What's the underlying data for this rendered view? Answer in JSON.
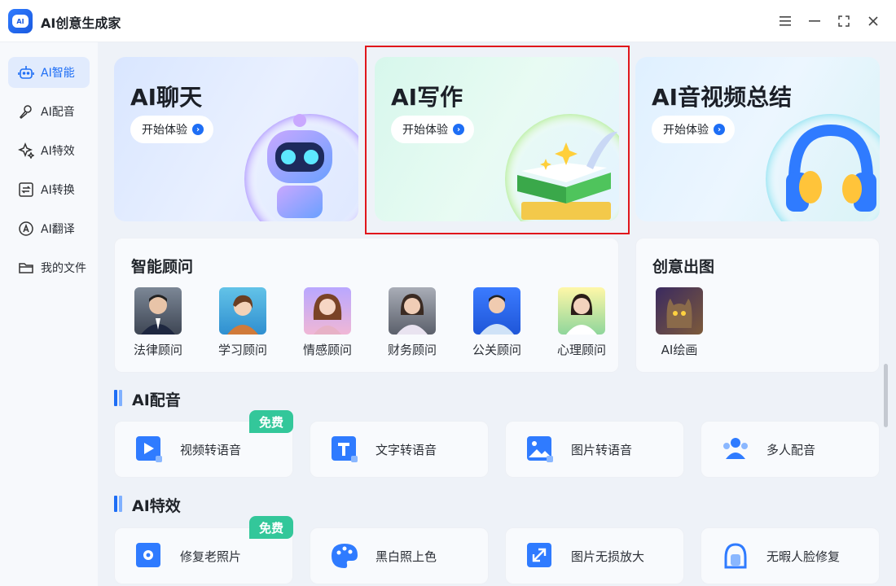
{
  "app": {
    "title": "AI创意生成家",
    "logo_text": "AI"
  },
  "window_controls": [
    "menu-icon",
    "minimize-icon",
    "maximize-icon",
    "close-icon"
  ],
  "sidebar": {
    "items": [
      {
        "label": "AI智能",
        "icon": "robot-icon",
        "active": true
      },
      {
        "label": "AI配音",
        "icon": "microphone-icon",
        "active": false
      },
      {
        "label": "AI特效",
        "icon": "sparkle-icon",
        "active": false
      },
      {
        "label": "AI转换",
        "icon": "convert-icon",
        "active": false
      },
      {
        "label": "AI翻译",
        "icon": "translate-icon",
        "active": false
      },
      {
        "label": "我的文件",
        "icon": "folder-icon",
        "active": false
      }
    ]
  },
  "hero": [
    {
      "title": "AI聊天",
      "button": "开始体验"
    },
    {
      "title": "AI写作",
      "button": "开始体验"
    },
    {
      "title": "AI音视频总结",
      "button": "开始体验"
    }
  ],
  "advisors": {
    "title": "智能顾问",
    "items": [
      {
        "name": "法律顾问"
      },
      {
        "name": "学习顾问"
      },
      {
        "name": "情感顾问"
      },
      {
        "name": "财务顾问"
      },
      {
        "name": "公关顾问"
      },
      {
        "name": "心理顾问"
      }
    ]
  },
  "creative": {
    "title": "创意出图",
    "items": [
      {
        "name": "AI绘画"
      }
    ]
  },
  "dubbing": {
    "title": "AI配音",
    "badge": "免费",
    "items": [
      {
        "label": "视频转语音",
        "icon": "video-to-voice-icon"
      },
      {
        "label": "文字转语音",
        "icon": "text-to-voice-icon"
      },
      {
        "label": "图片转语音",
        "icon": "image-to-voice-icon"
      },
      {
        "label": "多人配音",
        "icon": "multi-voice-icon"
      }
    ]
  },
  "effects": {
    "title": "AI特效",
    "badge": "免费",
    "items": [
      {
        "label": "修复老照片",
        "icon": "photo-repair-icon"
      },
      {
        "label": "黑白照上色",
        "icon": "palette-icon"
      },
      {
        "label": "图片无损放大",
        "icon": "upscale-icon"
      },
      {
        "label": "无暇人脸修复",
        "icon": "face-repair-icon"
      }
    ]
  },
  "colors": {
    "accent": "#1e6ef5",
    "badge": "#33c79a",
    "highlight": "#e0161b"
  }
}
